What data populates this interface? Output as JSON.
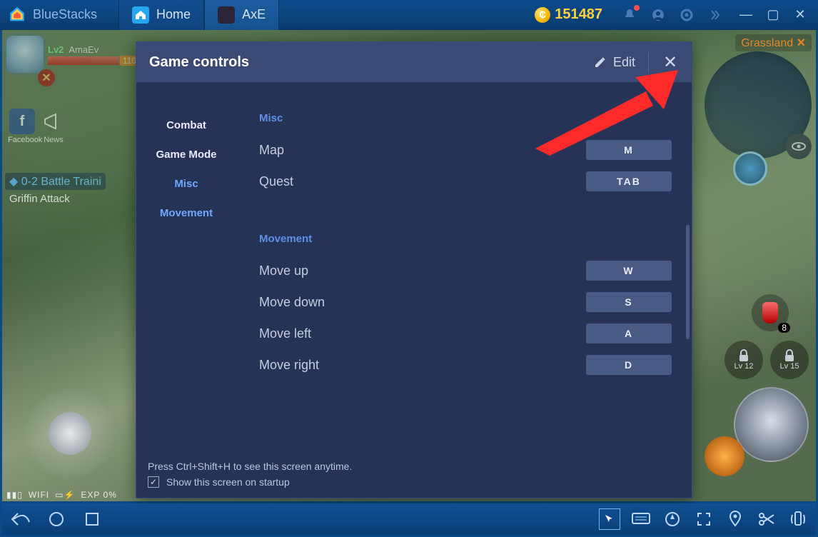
{
  "titlebar": {
    "app_name": "BlueStacks",
    "tabs": [
      {
        "label": "Home",
        "icon": "home-icon",
        "active": false
      },
      {
        "label": "AxE",
        "icon": "axe-icon",
        "active": true
      }
    ],
    "coins": "151487"
  },
  "game_hud": {
    "level_tag": "Lv2",
    "player_name": "AmaEv",
    "hp_text": "110",
    "social": [
      {
        "label": "Facebook"
      },
      {
        "label": "News"
      }
    ],
    "quest_title": "0-2 Battle Traini",
    "quest_sub": "Griffin Attack",
    "region": "Grassland",
    "potion_count": "8",
    "locks": [
      {
        "label": "Lv 12"
      },
      {
        "label": "Lv 15"
      }
    ],
    "status": {
      "wifi": "WIFI",
      "exp": "EXP 0%"
    }
  },
  "modal": {
    "title": "Game controls",
    "edit_label": "Edit",
    "categories": [
      {
        "name": "Combat",
        "active": false
      },
      {
        "name": "Game Mode",
        "active": false
      },
      {
        "name": "Misc",
        "active": true
      },
      {
        "name": "Movement",
        "active": true
      }
    ],
    "groups": [
      {
        "title": "Misc",
        "rows": [
          {
            "label": "Map",
            "key": "M"
          },
          {
            "label": "Quest",
            "key": "TAB"
          }
        ]
      },
      {
        "title": "Movement",
        "rows": [
          {
            "label": "Move up",
            "key": "W"
          },
          {
            "label": "Move down",
            "key": "S"
          },
          {
            "label": "Move left",
            "key": "A"
          },
          {
            "label": "Move right",
            "key": "D"
          }
        ]
      }
    ],
    "footer_hint": "Press Ctrl+Shift+H to see this screen anytime.",
    "footer_check_label": "Show this screen on startup",
    "footer_checked": true
  }
}
